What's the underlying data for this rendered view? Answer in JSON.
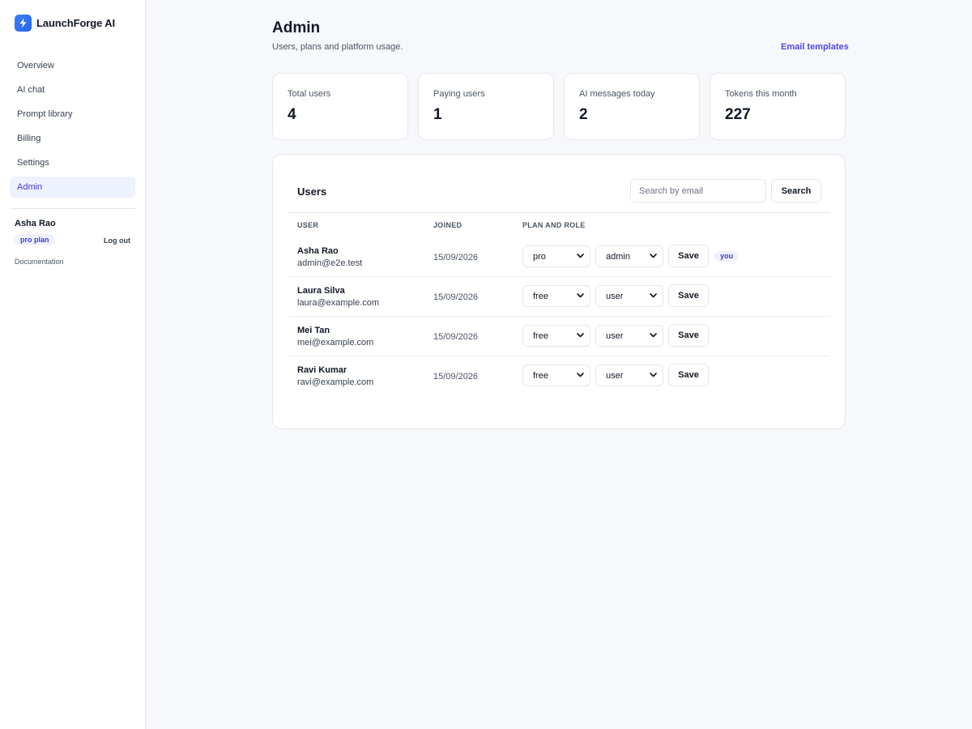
{
  "brand": {
    "name": "LaunchForge AI"
  },
  "sidebar": {
    "items": [
      {
        "label": "Overview",
        "active": false
      },
      {
        "label": "AI chat",
        "active": false
      },
      {
        "label": "Prompt library",
        "active": false
      },
      {
        "label": "Billing",
        "active": false
      },
      {
        "label": "Settings",
        "active": false
      },
      {
        "label": "Admin",
        "active": true
      }
    ],
    "user": {
      "name": "Asha Rao",
      "plan_badge": "pro plan",
      "logout_label": "Log out"
    },
    "docs_label": "Documentation"
  },
  "header": {
    "title": "Admin",
    "subtitle": "Users, plans and platform usage.",
    "email_templates_label": "Email templates"
  },
  "stats": [
    {
      "label": "Total users",
      "value": "4"
    },
    {
      "label": "Paying users",
      "value": "1"
    },
    {
      "label": "AI messages today",
      "value": "2"
    },
    {
      "label": "Tokens this month",
      "value": "227"
    }
  ],
  "users_panel": {
    "title": "Users",
    "search": {
      "placeholder": "Search by email",
      "value": "",
      "button_label": "Search"
    },
    "columns": [
      "USER",
      "JOINED",
      "PLAN AND ROLE"
    ],
    "save_label": "Save",
    "rows": [
      {
        "name": "Asha Rao",
        "email": "admin@e2e.test",
        "joined": "15/09/2026",
        "plan": "pro",
        "role": "admin",
        "badge": "you"
      },
      {
        "name": "Laura Silva",
        "email": "laura@example.com",
        "joined": "15/09/2026",
        "plan": "free",
        "role": "user",
        "badge": ""
      },
      {
        "name": "Mei Tan",
        "email": "mei@example.com",
        "joined": "15/09/2026",
        "plan": "free",
        "role": "user",
        "badge": ""
      },
      {
        "name": "Ravi Kumar",
        "email": "ravi@example.com",
        "joined": "15/09/2026",
        "plan": "free",
        "role": "user",
        "badge": ""
      }
    ]
  },
  "colors": {
    "accent": "#4f46e5",
    "active_bg": "#eef2ff",
    "brand_logo": "#3b82f6"
  },
  "icons": {
    "brand": "lightning-bolt-icon",
    "select": "chevron-down-icon"
  }
}
